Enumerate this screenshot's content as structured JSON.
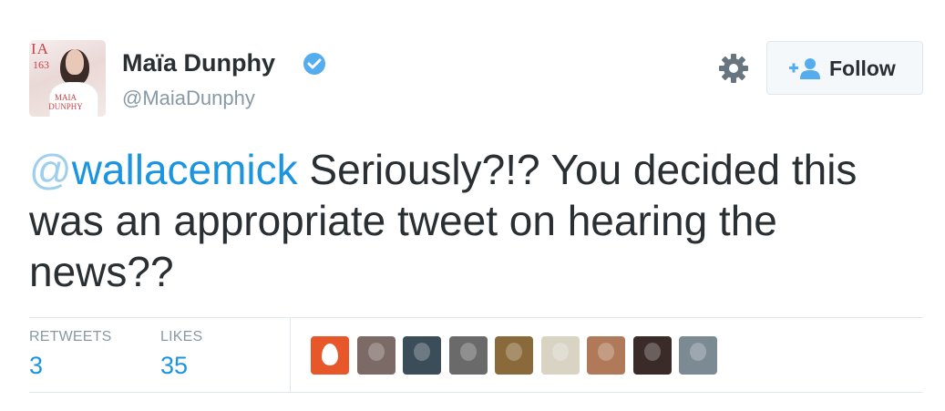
{
  "user": {
    "display_name": "Maïa Dunphy",
    "handle": "@MaiaDunphy",
    "avatar_text": {
      "masthead": "IA",
      "issue": "163",
      "cover_name": "MAIA DUNPHY"
    }
  },
  "follow_button": {
    "label": "Follow",
    "icon": "add-person-icon"
  },
  "settings": {
    "icon": "gear-icon"
  },
  "tweet": {
    "mention": "@wallacemick",
    "mention_at": "@",
    "mention_name": "wallacemick",
    "text": " Seriously?!? You decided this was an appropriate tweet on hearing the news??"
  },
  "stats": {
    "retweets_label": "RETWEETS",
    "retweets_value": "3",
    "likes_label": "LIKES",
    "likes_value": "35"
  },
  "favoriters": [
    {
      "name": "favoriter-egg-avatar",
      "color": "#e8572a"
    },
    {
      "name": "favoriter-avatar-2",
      "color": "#7b6a66"
    },
    {
      "name": "favoriter-avatar-3",
      "color": "#3c4d5a"
    },
    {
      "name": "favoriter-avatar-4",
      "color": "#6a6a6a"
    },
    {
      "name": "favoriter-avatar-5",
      "color": "#8a6a3a"
    },
    {
      "name": "favoriter-avatar-6",
      "color": "#d9d3c4"
    },
    {
      "name": "favoriter-avatar-7",
      "color": "#b07a5a"
    },
    {
      "name": "favoriter-avatar-8",
      "color": "#3a2a28"
    },
    {
      "name": "favoriter-avatar-9",
      "color": "#7c8a94"
    }
  ],
  "colors": {
    "link": "#1b95e0",
    "verified": "#55acee",
    "muted": "#8899a6",
    "text": "#292f33"
  }
}
